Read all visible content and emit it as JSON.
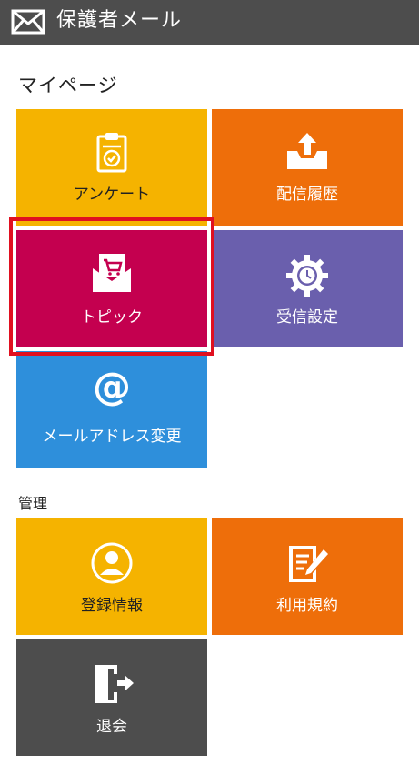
{
  "header": {
    "title": "保護者メール",
    "icon": "envelope-icon"
  },
  "sections": {
    "mypage": "マイページ",
    "admin": "管理"
  },
  "tiles": {
    "survey": {
      "label": "アンケート",
      "icon": "clipboard-check-icon",
      "color": "#f5b300"
    },
    "history": {
      "label": "配信履歴",
      "icon": "inbox-upload-icon",
      "color": "#ee6e0a"
    },
    "topics": {
      "label": "トピック",
      "icon": "cart-envelope-icon",
      "color": "#c4004f"
    },
    "receive": {
      "label": "受信設定",
      "icon": "clock-gear-icon",
      "color": "#6a5fad"
    },
    "email": {
      "label": "メールアドレス変更",
      "icon": "at-sign-icon",
      "color": "#2e8fdb"
    },
    "register": {
      "label": "登録情報",
      "icon": "user-circle-icon",
      "color": "#f5b300"
    },
    "terms": {
      "label": "利用規約",
      "icon": "document-pen-icon",
      "color": "#ee6e0a"
    },
    "logout": {
      "label": "退会",
      "icon": "exit-door-icon",
      "color": "#4d4d4d"
    }
  },
  "at_symbol": "@",
  "selected_tile": "topics",
  "highlight_color": "#e01020"
}
